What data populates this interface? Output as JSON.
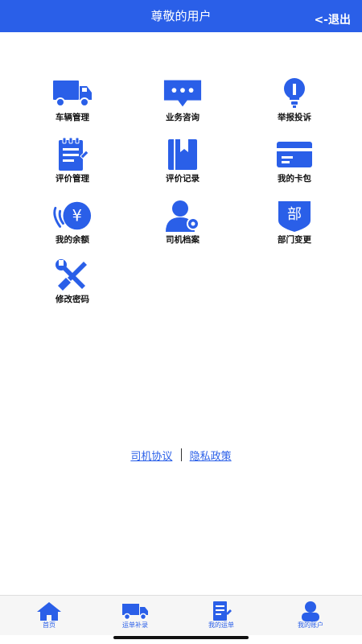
{
  "header": {
    "title": "尊敬的用户",
    "logout_label": "<-退出"
  },
  "menu": [
    {
      "label": "车辆管理",
      "icon": "truck-icon"
    },
    {
      "label": "业务咨询",
      "icon": "chat-bubble-icon"
    },
    {
      "label": "举报投诉",
      "icon": "lightbulb-icon"
    },
    {
      "label": "评价管理",
      "icon": "notepad-pen-icon"
    },
    {
      "label": "评价记录",
      "icon": "bookmark-book-icon"
    },
    {
      "label": "我的卡包",
      "icon": "card-icon"
    },
    {
      "label": "我的余额",
      "icon": "yuan-coin-icon",
      "glyph": "¥"
    },
    {
      "label": "司机档案",
      "icon": "user-gear-icon"
    },
    {
      "label": "部门变更",
      "icon": "department-shield-icon",
      "glyph": "部"
    },
    {
      "label": "修改密码",
      "icon": "wrench-screwdriver-icon"
    }
  ],
  "links": {
    "agreement": "司机协议",
    "privacy": "隐私政策"
  },
  "tabbar": [
    {
      "label": "首页",
      "icon": "home-icon"
    },
    {
      "label": "运单补录",
      "icon": "truck-icon"
    },
    {
      "label": "我的运单",
      "icon": "document-pen-icon"
    },
    {
      "label": "我的账户",
      "icon": "user-icon"
    }
  ],
  "colors": {
    "primary": "#2a5fe8",
    "text": "#111111",
    "tabbar_bg": "#f6f6f6"
  }
}
